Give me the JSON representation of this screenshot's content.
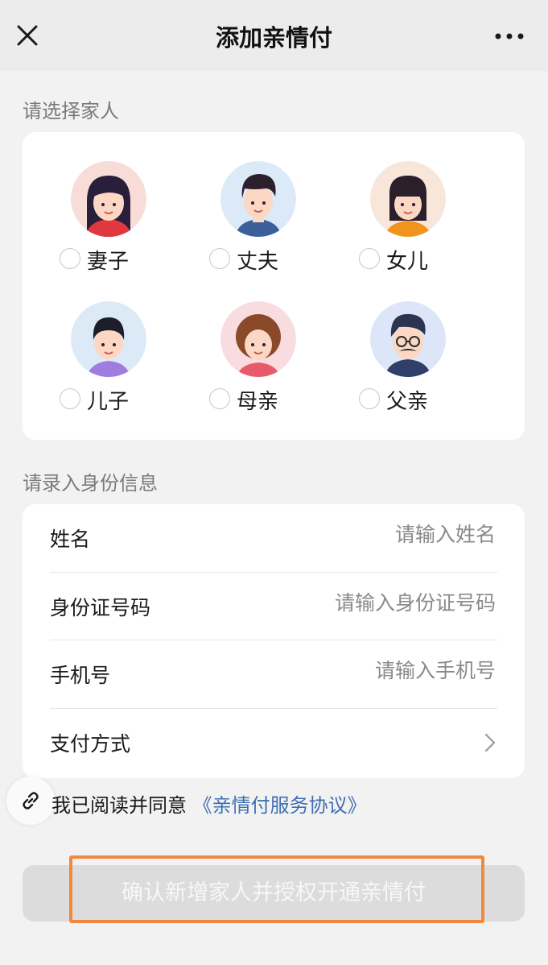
{
  "navbar": {
    "title": "添加亲情付",
    "close_icon": "close-icon",
    "more_icon": "more-icon"
  },
  "family": {
    "label": "请选择家人",
    "members": [
      {
        "name": "妻子"
      },
      {
        "name": "丈夫"
      },
      {
        "name": "女儿"
      },
      {
        "name": "儿子"
      },
      {
        "name": "母亲"
      },
      {
        "name": "父亲"
      }
    ]
  },
  "identity": {
    "label": "请录入身份信息",
    "fields": [
      {
        "label": "姓名",
        "placeholder": "请输入姓名"
      },
      {
        "label": "身份证号码",
        "placeholder": "请输入身份证号码"
      },
      {
        "label": "手机号",
        "placeholder": "请输入手机号"
      }
    ],
    "payment": {
      "label": "支付方式"
    }
  },
  "agreement": {
    "prefix": "我已阅读并同意",
    "link": "《亲情付服务协议》"
  },
  "confirm": {
    "label": "确认新增家人并授权开通亲情付"
  },
  "colors": {
    "accent_link": "#3f6fb3",
    "highlight": "#f0883e",
    "button_disabled": "#dcdcdc"
  }
}
